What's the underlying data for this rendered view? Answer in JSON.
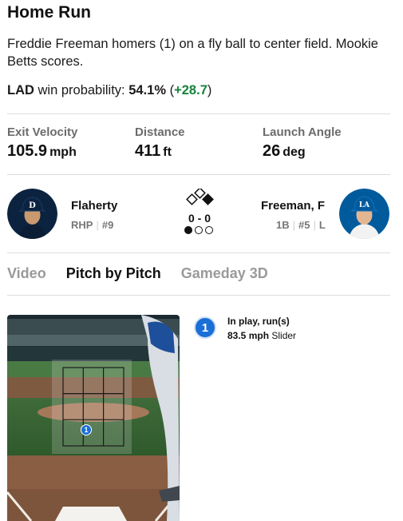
{
  "play": {
    "title": "Home Run",
    "description": "Freddie Freeman homers (1) on a fly ball to center field. Mookie Betts scores.",
    "win_prob": {
      "team": "LAD",
      "label": " win probability: ",
      "pct": "54.1%",
      "open": " (",
      "delta": "+28.7",
      "close": ")"
    }
  },
  "stats": [
    {
      "label": "Exit Velocity",
      "value": "105.9",
      "unit": "mph"
    },
    {
      "label": "Distance",
      "value": "411",
      "unit": "ft"
    },
    {
      "label": "Launch Angle",
      "value": "26",
      "unit": "deg"
    }
  ],
  "pitcher": {
    "name": "Flaherty",
    "pos": "RHP",
    "num": "#9",
    "team_color": "#0c2340"
  },
  "batter": {
    "name": "Freeman, F",
    "pos": "1B",
    "num": "#5",
    "bats": "L",
    "team_color": "#005a9c"
  },
  "situation": {
    "count": "0 - 0",
    "outs": 1,
    "total_outs": 3,
    "bases": {
      "first": false,
      "second": false,
      "third": false
    }
  },
  "tabs": [
    {
      "label": "Video",
      "active": false
    },
    {
      "label": "Pitch by Pitch",
      "active": true
    },
    {
      "label": "Gameday 3D",
      "active": false
    }
  ],
  "pitch": {
    "number": "1",
    "result": "In play, run(s)",
    "speed": "83.5 mph",
    "type": "Slider",
    "accent": "#1a6fd6"
  }
}
